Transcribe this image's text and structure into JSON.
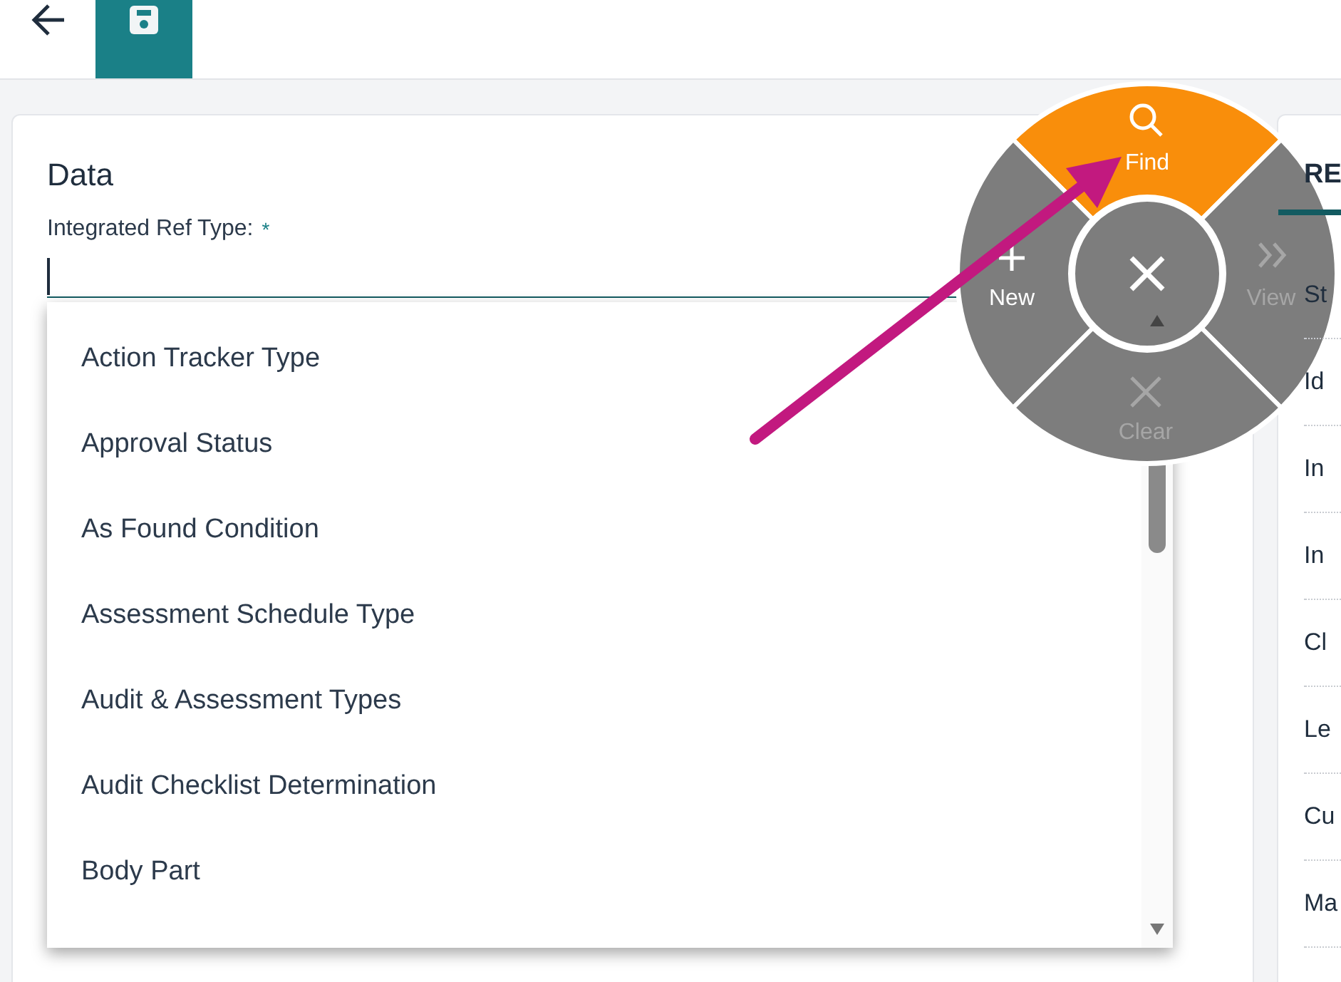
{
  "section": {
    "title": "Data",
    "field": {
      "label": "Integrated Ref Type:",
      "required_mark": "*",
      "focused": true
    }
  },
  "dropdown": {
    "options": [
      "Action Tracker Type",
      "Approval Status",
      "As Found Condition",
      "Assessment Schedule Type",
      "Audit & Assessment Types",
      "Audit Checklist Determination",
      "Body Part"
    ]
  },
  "radial_menu": {
    "items": [
      {
        "kind": "find",
        "label": "Find",
        "selected": true,
        "disabled": false
      },
      {
        "kind": "new",
        "label": "New",
        "selected": false,
        "disabled": false
      },
      {
        "kind": "view",
        "label": "View",
        "selected": false,
        "disabled": true
      },
      {
        "kind": "clear",
        "label": "Clear",
        "selected": false,
        "disabled": true
      }
    ]
  },
  "right_panel": {
    "tab": "RE",
    "rows": [
      "St",
      "Id",
      "In",
      "In",
      "Cl",
      "Le",
      "Cu",
      "Ma"
    ]
  }
}
